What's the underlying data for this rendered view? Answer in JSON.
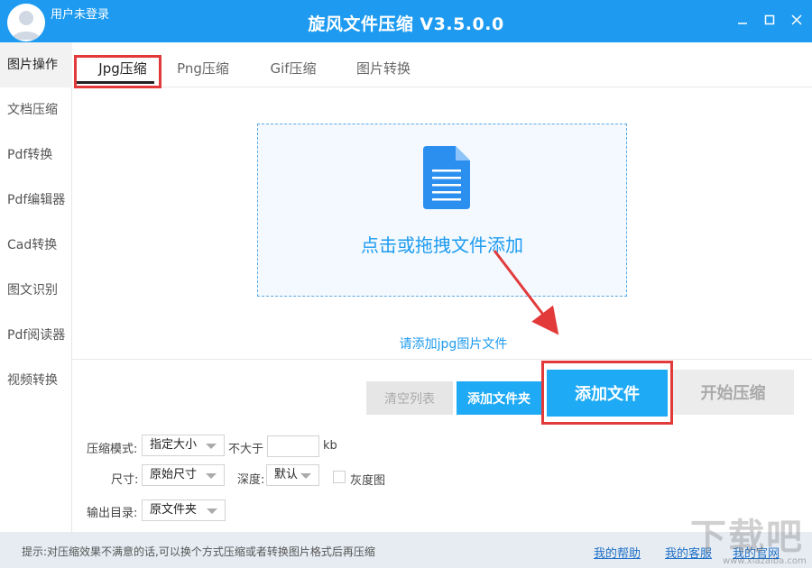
{
  "window": {
    "user_label": "用户未登录",
    "title": "旋风文件压缩 V3.5.0.0"
  },
  "sidebar": {
    "items": [
      {
        "label": "图片操作",
        "active": true
      },
      {
        "label": "文档压缩"
      },
      {
        "label": "Pdf转换"
      },
      {
        "label": "Pdf编辑器"
      },
      {
        "label": "Cad转换"
      },
      {
        "label": "图文识别"
      },
      {
        "label": "Pdf阅读器"
      },
      {
        "label": "视频转换"
      }
    ]
  },
  "tabs": [
    {
      "label": "Jpg压缩",
      "active": true
    },
    {
      "label": "Png压缩"
    },
    {
      "label": "Gif压缩"
    },
    {
      "label": "图片转换"
    }
  ],
  "dropzone": {
    "text": "点击或拖拽文件添加",
    "icon": "document-icon"
  },
  "hint": "请添加jpg图片文件",
  "actions": {
    "clear": "清空列表",
    "add_folder": "添加文件夹",
    "add_file": "添加文件",
    "start": "开始压缩"
  },
  "settings": {
    "mode_label": "压缩模式:",
    "mode_value": "指定大小",
    "max_label": "不大于",
    "max_value": "",
    "unit": "kb",
    "size_label": "尺寸:",
    "size_value": "原始尺寸",
    "depth_label": "深度:",
    "depth_value": "默认",
    "grayscale_label": "灰度图",
    "grayscale_checked": false,
    "output_label": "输出目录:",
    "output_value": "原文件夹"
  },
  "footer": {
    "tip": "提示:对压缩效果不满意的话,可以换个方式压缩或者转换图片格式后再压缩",
    "help": "我的帮助",
    "service": "我的客服",
    "website": "我的官网"
  },
  "watermark": {
    "big": "下载吧",
    "small": "www.xiazaiba.com"
  },
  "colors": {
    "accent": "#1e9bf0",
    "button": "#1eaaf5",
    "highlight": "#e23a3a"
  }
}
